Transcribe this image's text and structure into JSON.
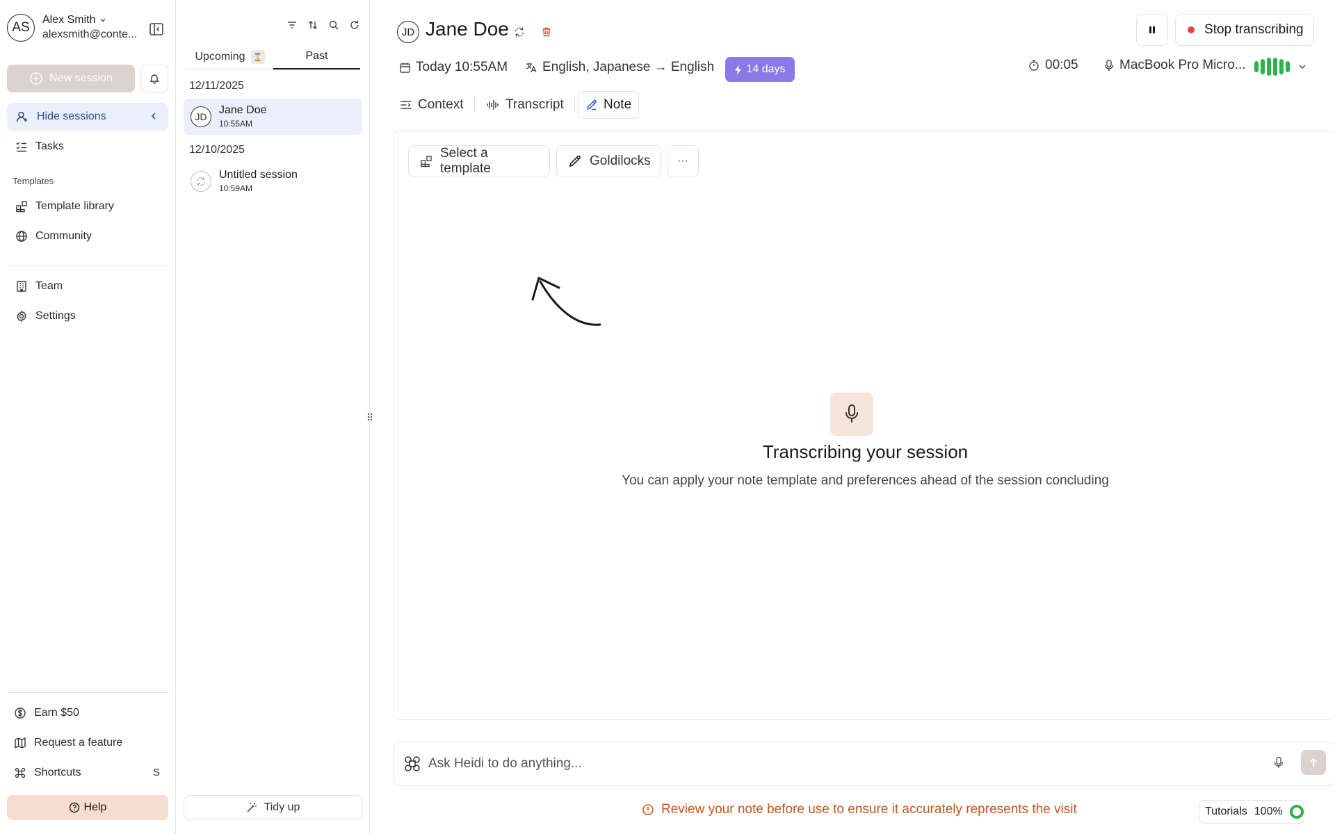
{
  "user": {
    "initials": "AS",
    "name": "Alex Smith",
    "email": "alexsmith@conte..."
  },
  "sidebar": {
    "new_session_label": "New session",
    "hide_sessions_label": "Hide sessions",
    "tasks_label": "Tasks",
    "templates_section": "Templates",
    "template_library_label": "Template library",
    "community_label": "Community",
    "team_label": "Team",
    "settings_label": "Settings",
    "earn_label": "Earn $50",
    "request_feature_label": "Request a feature",
    "shortcuts_label": "Shortcuts",
    "shortcuts_key": "S",
    "help_label": "Help"
  },
  "sessions": {
    "tab_upcoming": "Upcoming",
    "tab_past": "Past",
    "groups": [
      {
        "date": "12/11/2025",
        "item": {
          "initials": "JD",
          "title": "Jane Doe",
          "time": "10:55AM"
        }
      },
      {
        "date": "12/10/2025",
        "item": {
          "title": "Untitled session",
          "time": "10:59AM"
        }
      }
    ],
    "tidy_label": "Tidy up"
  },
  "main": {
    "patient_initials": "JD",
    "patient_name": "Jane Doe",
    "stop_label": "Stop transcribing",
    "date_label": "Today 10:55AM",
    "language_label": "English, Japanese → English",
    "days_badge": "14 days",
    "timer": "00:05",
    "mic_device": "MacBook Pro Micro...",
    "view_tabs": {
      "context": "Context",
      "transcript": "Transcript",
      "note": "Note"
    },
    "select_template_label": "Select a template",
    "goldilocks_label": "Goldilocks",
    "more_label": "···",
    "empty_title": "Transcribing your session",
    "empty_subtitle": "You can apply your note template and preferences ahead of the session concluding",
    "ask_placeholder": "Ask Heidi to do anything...",
    "disclaimer": "Review your note before use to ensure it accurately represents the visit",
    "tutorials_label": "Tutorials",
    "tutorials_progress": "100%"
  },
  "colors": {
    "accent_purple": "#8b7ae6",
    "active_blue_bg": "#e9f0fb",
    "recording_red": "#e8433f",
    "mic_green": "#2eb24d",
    "warning_orange": "#c9541a",
    "help_bg": "#f5ddd0"
  }
}
